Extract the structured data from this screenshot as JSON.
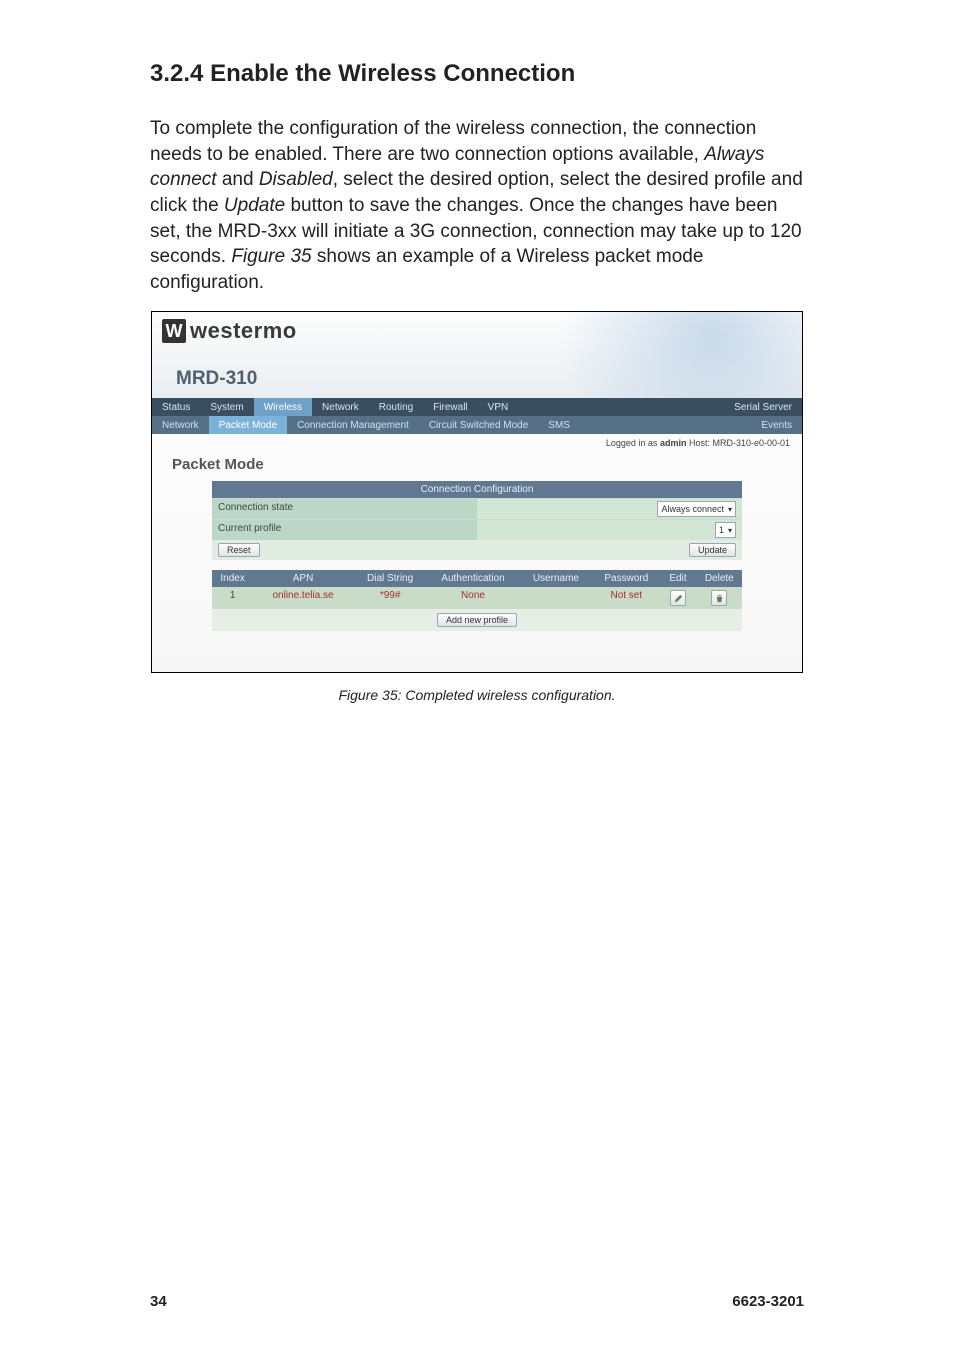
{
  "section": {
    "number": "3.2.4",
    "title": "Enable the Wireless Connection"
  },
  "body_parts": {
    "p1a": "To complete the configuration of the wireless connection, the connection needs to be enabled. There are two connection options available, ",
    "p1b": "Always connect",
    "p1c": " and ",
    "p1d": "Disabled",
    "p1e": ", select the desired option, select the desired profile and click the ",
    "p1f": "Update",
    "p1g": " button to save the changes. Once the changes have been set, the MRD-3xx will initiate a 3G connection, connection may take up to 120 seconds. ",
    "p1h": "Figure 35",
    "p1i": " shows an example of a Wireless packet mode configuration."
  },
  "screenshot": {
    "logo": {
      "mark": "W",
      "word": "westermo"
    },
    "model": "MRD-310",
    "nav": [
      "Status",
      "System",
      "Wireless",
      "Network",
      "Routing",
      "Firewall",
      "VPN",
      "Serial Server"
    ],
    "nav_active_index": 2,
    "subnav": [
      "Network",
      "Packet Mode",
      "Connection Management",
      "Circuit Switched Mode",
      "SMS",
      "Events"
    ],
    "subnav_active_index": 1,
    "logged_in": {
      "pre": "Logged in as ",
      "user": "admin",
      "post": " Host: MRD-310-e0-00-01"
    },
    "section_heading": "Packet Mode",
    "config": {
      "title": "Connection Configuration",
      "rows": [
        {
          "label": "Connection state",
          "value": "Always connect",
          "type": "dropdown"
        },
        {
          "label": "Current profile",
          "value": "1",
          "type": "dropdown"
        }
      ],
      "reset_btn": "Reset",
      "update_btn": "Update"
    },
    "profiles": {
      "headers": [
        "Index",
        "APN",
        "Dial String",
        "Authentication",
        "Username",
        "Password",
        "Edit",
        "Delete"
      ],
      "row": {
        "index": "1",
        "apn": "online.telia.se",
        "dial": "*99#",
        "auth": "None",
        "user": "",
        "pass": "Not set"
      },
      "add_btn": "Add new profile"
    }
  },
  "figure_caption": "Figure 35: Completed wireless configuration.",
  "footer": {
    "left": "34",
    "right": "6623-3201"
  }
}
